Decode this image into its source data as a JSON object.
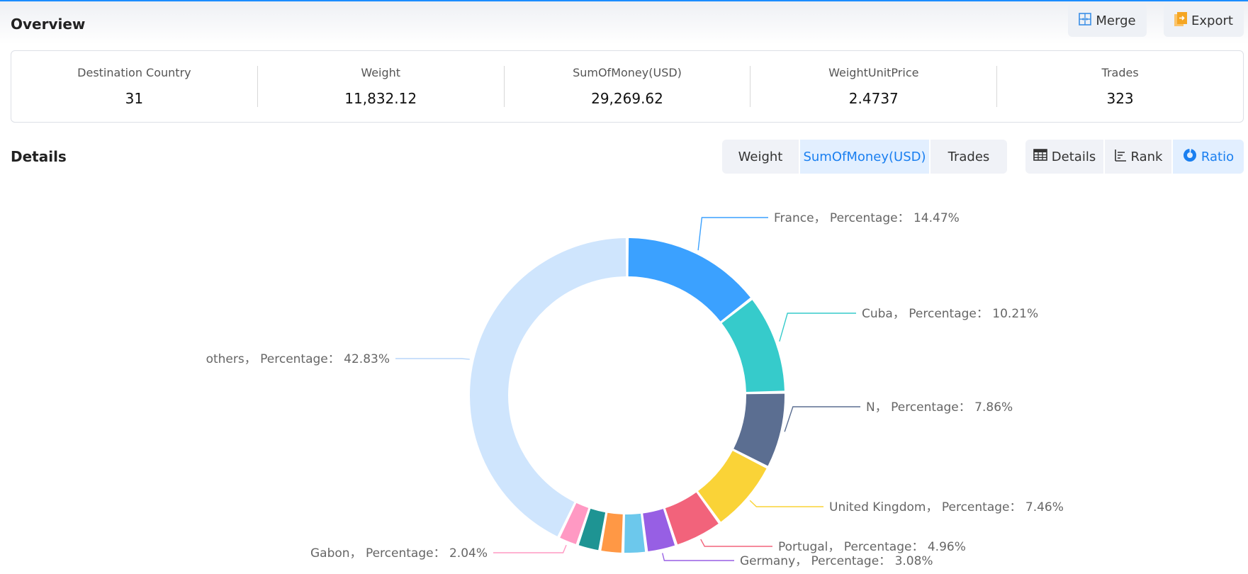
{
  "overview": {
    "title": "Overview",
    "merge_label": "Merge",
    "export_label": "Export",
    "stats": [
      {
        "label": "Destination Country",
        "value": "31"
      },
      {
        "label": "Weight",
        "value": "11,832.12"
      },
      {
        "label": "SumOfMoney(USD)",
        "value": "29,269.62"
      },
      {
        "label": "WeightUnitPrice",
        "value": "2.4737"
      },
      {
        "label": "Trades",
        "value": "323"
      }
    ]
  },
  "details": {
    "title": "Details",
    "metric_tabs": [
      {
        "label": "Weight",
        "active": false
      },
      {
        "label": "SumOfMoney(USD)",
        "active": true
      },
      {
        "label": "Trades",
        "active": false
      }
    ],
    "view_tabs": [
      {
        "label": "Details",
        "icon": "table-icon",
        "active": false
      },
      {
        "label": "Rank",
        "icon": "rank-bars-icon",
        "active": false
      },
      {
        "label": "Ratio",
        "icon": "donut-icon",
        "active": true
      }
    ]
  },
  "colors": {
    "accent": "#1a7ff0",
    "merge_icon": "#3a8ee6",
    "export_icon": "#f5a623"
  },
  "chart_data": {
    "type": "pie",
    "variant": "donut",
    "metric": "SumOfMoney(USD)",
    "label_format": "{name}， Percentage： {value}%",
    "slices": [
      {
        "name": "France",
        "value": 14.47,
        "color": "#3ba1ff",
        "labeled": true
      },
      {
        "name": "Cuba",
        "value": 10.21,
        "color": "#36cbcb",
        "labeled": true
      },
      {
        "name": "N",
        "value": 7.86,
        "color": "#5b6e91",
        "labeled": true
      },
      {
        "name": "United Kingdom",
        "value": 7.46,
        "color": "#fad337",
        "labeled": true
      },
      {
        "name": "Portugal",
        "value": 4.96,
        "color": "#f2637b",
        "labeled": true
      },
      {
        "name": "Germany",
        "value": 3.08,
        "color": "#975fe4",
        "labeled": true
      },
      {
        "name": "",
        "value": 2.4,
        "color": "#6cc8ec",
        "labeled": false
      },
      {
        "name": "",
        "value": 2.35,
        "color": "#ff9845",
        "labeled": false
      },
      {
        "name": "",
        "value": 2.34,
        "color": "#1e9493",
        "labeled": false
      },
      {
        "name": "Gabon",
        "value": 2.04,
        "color": "#ff99c3",
        "labeled": true
      },
      {
        "name": "others",
        "value": 42.83,
        "color": "#cfe5fd",
        "labeled": true
      }
    ]
  }
}
